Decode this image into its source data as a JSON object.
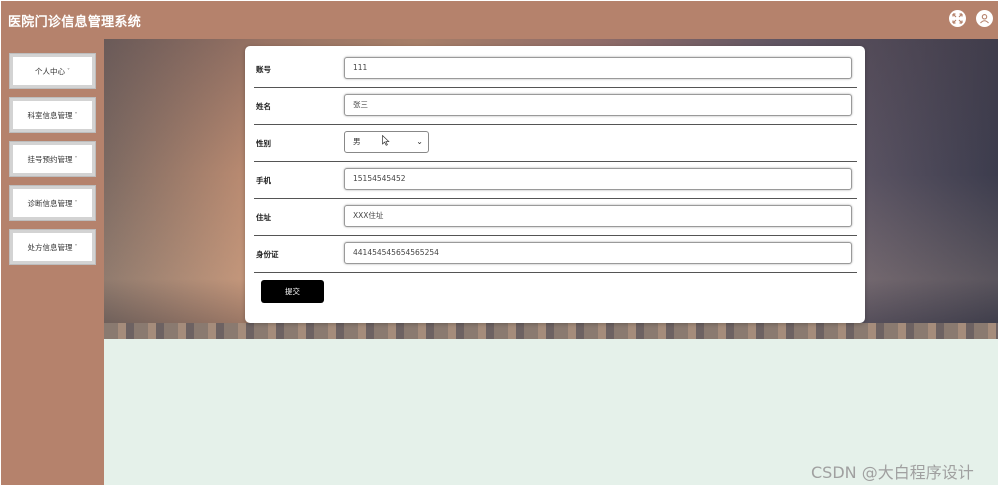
{
  "header": {
    "title": "医院门诊信息管理系统",
    "icons": [
      "fullscreen-icon",
      "user-icon"
    ]
  },
  "sidebar": {
    "items": [
      {
        "label": "个人中心",
        "caret": "˅"
      },
      {
        "label": "科室信息管理",
        "caret": "˅"
      },
      {
        "label": "挂号预约管理",
        "caret": "˅"
      },
      {
        "label": "诊断信息管理",
        "caret": "˅"
      },
      {
        "label": "处方信息管理",
        "caret": "˅"
      }
    ]
  },
  "form": {
    "fields": [
      {
        "label": "账号",
        "value": "111"
      },
      {
        "label": "姓名",
        "value": "张三"
      },
      {
        "label": "性别",
        "value": "男"
      },
      {
        "label": "手机",
        "value": "15154545452"
      },
      {
        "label": "住址",
        "value": "XXX住址"
      },
      {
        "label": "身份证",
        "value": "441454545654565254"
      }
    ],
    "submit_label": "提交"
  },
  "watermark": "CSDN @大白程序设计"
}
